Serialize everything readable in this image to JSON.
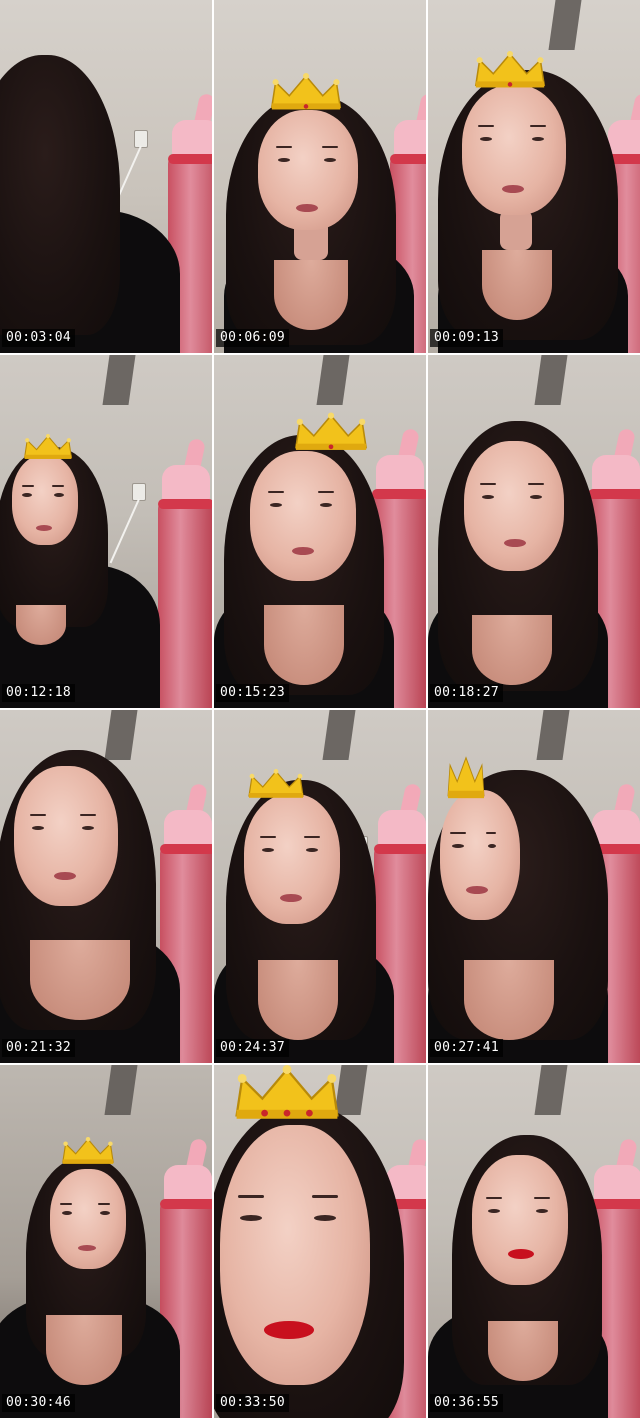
{
  "contact_sheet": {
    "timestamps": [
      "00:03:04",
      "00:06:09",
      "00:09:13",
      "00:12:18",
      "00:15:23",
      "00:18:27",
      "00:21:32",
      "00:24:37",
      "00:27:41",
      "00:30:46",
      "00:33:50",
      "00:36:55"
    ],
    "overlay_icon": "crown-icon",
    "colors": {
      "timestamp_bg": "#000000",
      "timestamp_text": "#ffffff",
      "crown_gold": "#f2c21b",
      "bottle_pink": "#e3889a",
      "wall": "#c9c3bb"
    }
  }
}
